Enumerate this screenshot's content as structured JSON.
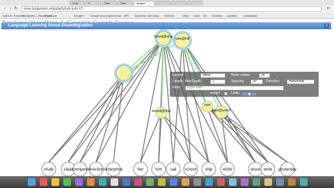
{
  "browser": {
    "tabs": [
      {
        "label": "Ling"
      },
      {
        "label": "tr"
      },
      {
        "label": "New"
      },
      {
        "label": "New"
      },
      {
        "label": "langwe"
      },
      {
        "label": "..."
      },
      {
        "label": "..."
      },
      {
        "label": "..."
      }
    ],
    "url": "www.langwaren.singularityhub.pub/ #1",
    "bookmarks": [
      "Links to Theorem",
      "Wordpress - Resources",
      "Facebook",
      "Google+",
      "Google Docs",
      "OpenGLwe",
      "MPI",
      "Business",
      "Get Data",
      "Science",
      "Links",
      "Latex",
      "3D",
      "Tutorials",
      "Lambda",
      "Landlocked"
    ]
  },
  "page": {
    "demo_title": "Scaling WordNet & Google Graph Demo",
    "panel_title": "Language Learning Sense Disambiguation",
    "collapse_symbol": "▾"
  },
  "settings": {
    "layout_label": "Layout",
    "layout_value": "None",
    "node_radius_label": "Node radius",
    "node_radius_value": "30",
    "levels_label": "Levels",
    "max_depth_label": "MaxDepth",
    "max_depth_value": "1",
    "spacing_label": "Spacing",
    "spacing_value": "30",
    "direction_label": "Direction",
    "direction_value": "Horizontal",
    "filter_label": "Filter",
    "filter_placeholder": "Type filter",
    "weight_label": "weight",
    "links_label": "Links"
  },
  "graph": {
    "senses": [
      {
        "id": "s1",
        "label": "beard@ship",
        "highlight": true
      },
      {
        "id": "s2",
        "label": "saw@hill",
        "highlight": true
      },
      {
        "id": "s3",
        "label": "beard@ship",
        "highlight": false
      },
      {
        "id": "s4",
        "label": "saw",
        "highlight": false
      },
      {
        "id": "s5",
        "label": "saw@wood",
        "highlight": false
      },
      {
        "id": "s6",
        "label": "",
        "highlight": true
      }
    ],
    "words": [
      "chalk",
      "clear",
      "compare",
      "direction",
      "enterprise",
      "her",
      "him",
      "sail",
      "school",
      "ship",
      "white",
      "wood",
      "write",
      "yesterday"
    ]
  },
  "dock": {
    "colors": [
      "#5aa0e8",
      "#e85a5a",
      "#f0c040",
      "#50c050",
      "#9a6ae0",
      "#e88a3a",
      "#3ab0b0",
      "#e0e0e0",
      "#4a7ad0",
      "#d05080",
      "#70b070",
      "#c0c040",
      "#6080e0",
      "#e0a060",
      "#909090",
      "#40a0d0",
      "#d06060",
      "#80c0e0",
      "#b070d0",
      "#60a080",
      "#e0c080",
      "#7090b0",
      "#c08040",
      "#50b0a0"
    ]
  },
  "colors": {
    "panel_header": "#5a8ccc",
    "node_fill": "#f2f2a0",
    "node_ring": "#a8d8f0",
    "link_green": "#7be37b",
    "link_gray": "#6a6a6a"
  }
}
